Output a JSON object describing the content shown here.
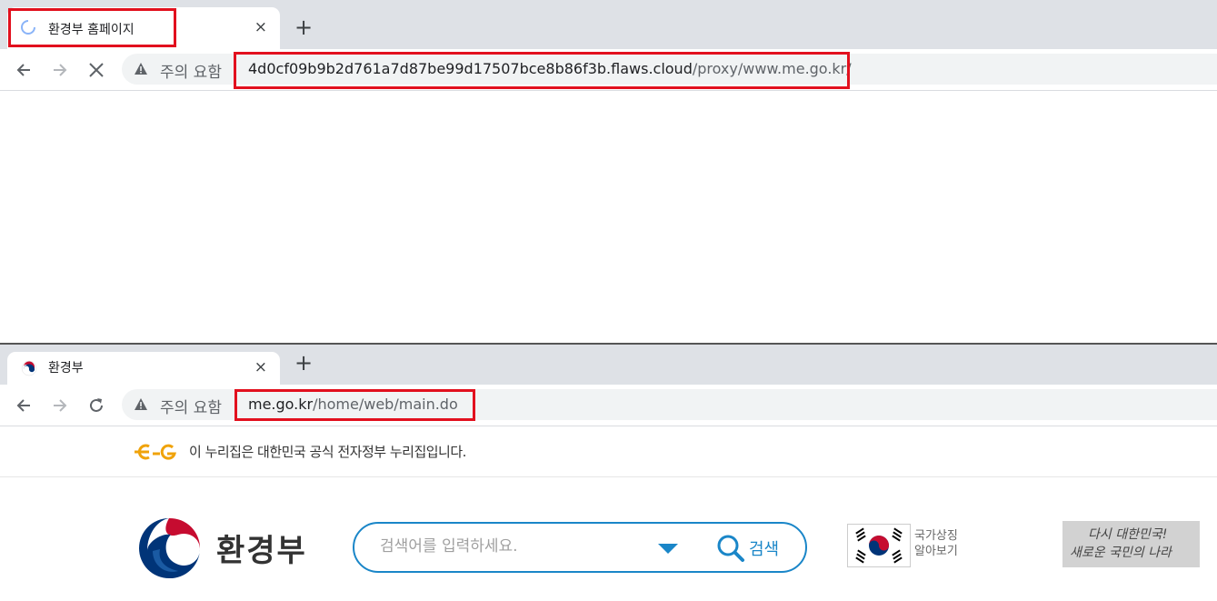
{
  "top_window": {
    "tab_title": "환경부 홈페이지",
    "tab_close": "×",
    "new_tab": "+",
    "security_label": "주의 요함",
    "url_host": "4d0cf09b9b2d761a7d87be99d17507bce8b86f3b.flaws.cloud",
    "url_path": "/proxy/www.me.go.kr/"
  },
  "bottom_window": {
    "tab_title": "환경부",
    "tab_close": "×",
    "new_tab": "+",
    "security_label": "주의 요함",
    "url_host": "me.go.kr",
    "url_path": "/home/web/main.do"
  },
  "site": {
    "egov_notice": "이 누리집은 대한민국 공식 전자정부 누리집입니다.",
    "brand": "환경부",
    "search_placeholder": "검색어를 입력하세요.",
    "search_button": "검색",
    "symbols_label_line1": "국가상징",
    "symbols_label_line2": "알아보기",
    "slogan_line1": "다시 대한민국!",
    "slogan_line2": "새로운 국민의 나라"
  },
  "colors": {
    "highlight_red": "#e2101e",
    "accent_blue": "#1a86c8",
    "tabstrip": "#dee1e6"
  }
}
